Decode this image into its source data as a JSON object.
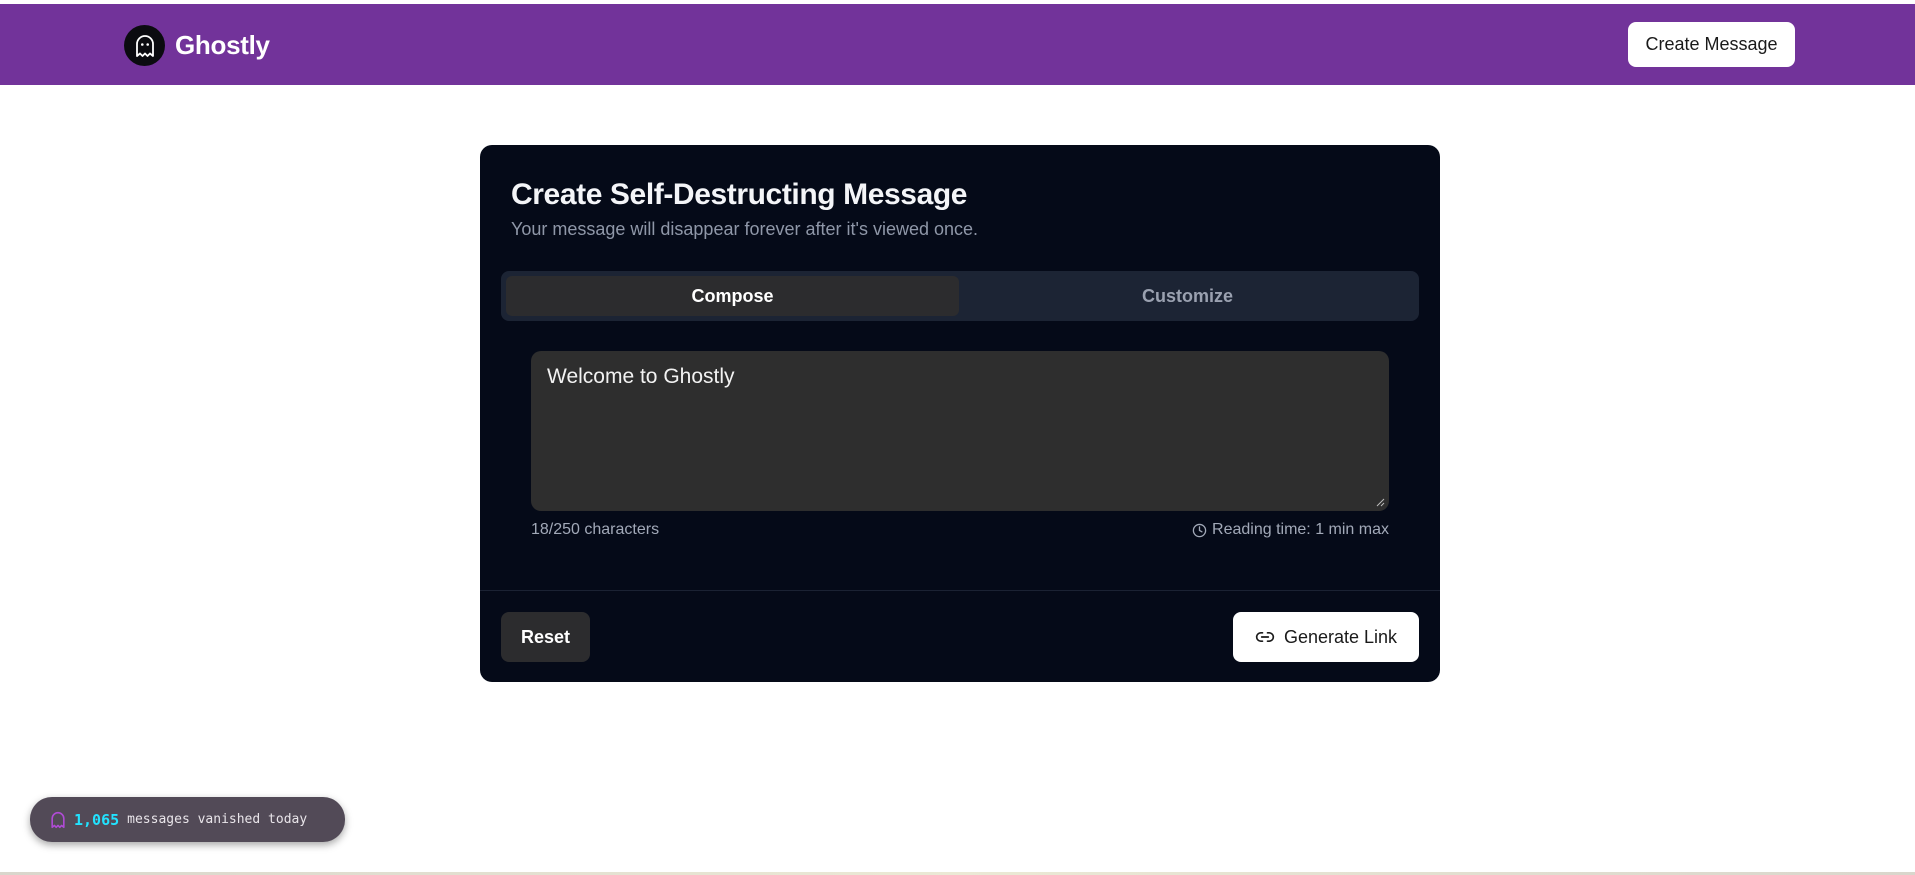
{
  "header": {
    "brand_name": "Ghostly",
    "logo_icon": "ghost-icon",
    "create_message_label": "Create Message",
    "background_color": "#72339a"
  },
  "card": {
    "title": "Create Self-Destructing Message",
    "subtitle": "Your message will disappear forever after it's viewed once.",
    "tabs": [
      {
        "label": "Compose",
        "active": true
      },
      {
        "label": "Customize",
        "active": false
      }
    ],
    "message_value": "Welcome to Ghostly",
    "char_count": "18/250 characters",
    "reading_time": "Reading time: 1 min max",
    "reading_time_icon": "clock-icon",
    "reset_label": "Reset",
    "generate_label": "Generate Link",
    "generate_icon": "link-icon",
    "background_color": "#050a18"
  },
  "stats": {
    "icon": "ghost-icon",
    "count": "1,065",
    "label": "messages vanished today",
    "count_color": "#22e3ff"
  }
}
